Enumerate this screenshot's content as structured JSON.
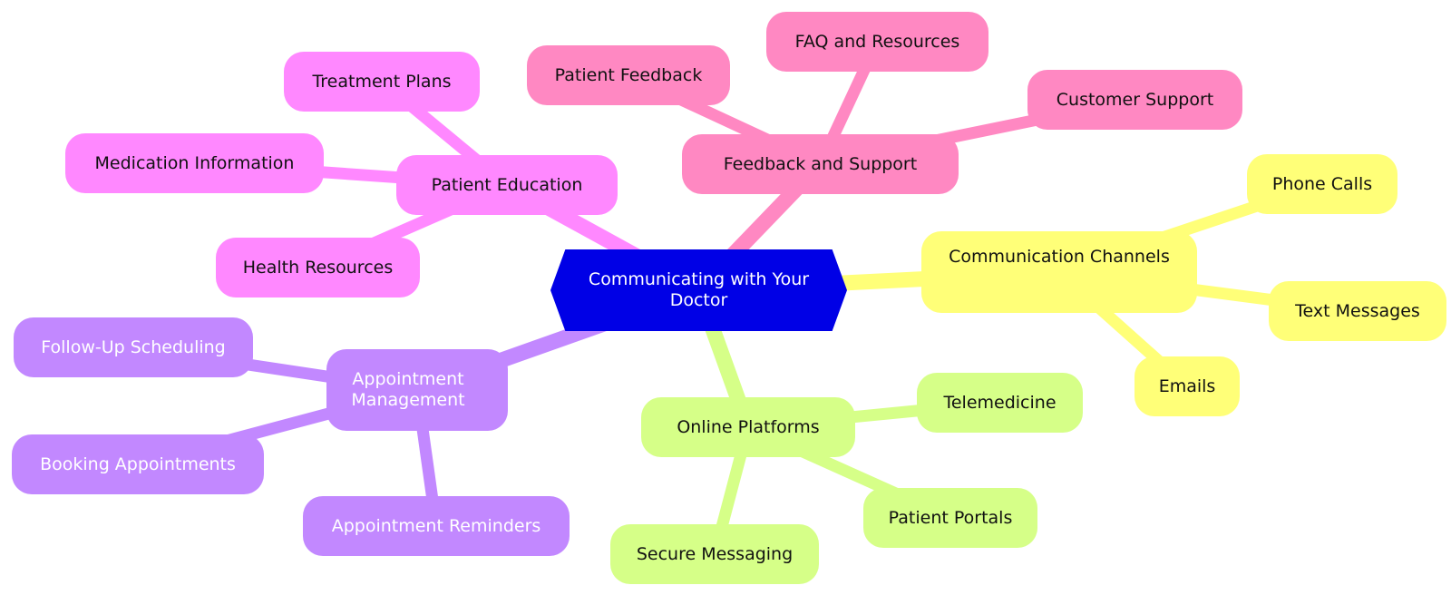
{
  "root": {
    "label": "Communicating with Your Doctor",
    "color": "#0000e6"
  },
  "branches": [
    {
      "id": "patient-education",
      "label": "Patient Education",
      "color": "#ff88ff",
      "text_color": "#111111",
      "children": [
        {
          "id": "treatment-plans",
          "label": "Treatment Plans"
        },
        {
          "id": "medication-information",
          "label": "Medication Information"
        },
        {
          "id": "health-resources",
          "label": "Health Resources"
        }
      ]
    },
    {
      "id": "feedback-and-support",
      "label": "Feedback and Support",
      "color": "#ff88c2",
      "text_color": "#111111",
      "children": [
        {
          "id": "patient-feedback",
          "label": "Patient Feedback"
        },
        {
          "id": "faq-and-resources",
          "label": "FAQ and Resources"
        },
        {
          "id": "customer-support",
          "label": "Customer Support"
        }
      ]
    },
    {
      "id": "communication-channels",
      "label": "Communication Channels",
      "color": "#ffff78",
      "text_color": "#111111",
      "children": [
        {
          "id": "phone-calls",
          "label": "Phone Calls"
        },
        {
          "id": "text-messages",
          "label": "Text Messages"
        },
        {
          "id": "emails",
          "label": "Emails"
        }
      ]
    },
    {
      "id": "online-platforms",
      "label": "Online Platforms",
      "color": "#d6ff88",
      "text_color": "#111111",
      "children": [
        {
          "id": "telemedicine",
          "label": "Telemedicine"
        },
        {
          "id": "patient-portals",
          "label": "Patient Portals"
        },
        {
          "id": "secure-messaging",
          "label": "Secure Messaging"
        }
      ]
    },
    {
      "id": "appointment-management",
      "label": "Appointment Management",
      "color": "#c288ff",
      "text_color": "#ffffff",
      "children": [
        {
          "id": "follow-up-scheduling",
          "label": "Follow-Up Scheduling"
        },
        {
          "id": "booking-appointments",
          "label": "Booking Appointments"
        },
        {
          "id": "appointment-reminders",
          "label": "Appointment Reminders"
        }
      ]
    }
  ]
}
